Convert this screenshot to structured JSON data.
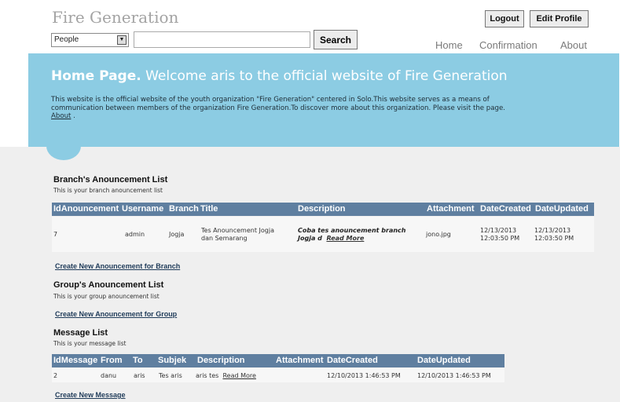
{
  "header": {
    "site_title": "Fire Generation",
    "logout_label": "Logout",
    "edit_profile_label": "Edit Profile",
    "search_category": "People",
    "search_value": "",
    "search_button": "Search",
    "nav": {
      "home": "Home",
      "confirmation": "Confirmation",
      "about": "About"
    }
  },
  "banner": {
    "title_bold": "Home Page.",
    "title_rest": "Welcome aris to the official website of Fire Generation",
    "text_line1": "This website is the official website of the youth organization \"Fire Generation\" centered in Solo.This website serves as a means of",
    "text_line2": "communication between members of the organization Fire Generation.To discover more about this organization. Please visit the page.",
    "about_link": "About",
    "after_link": " ."
  },
  "branch": {
    "title": "Branch's Anouncement List",
    "subtitle": "This is your branch anouncement list",
    "columns": [
      "IdAnouncement",
      "Username",
      "Branch",
      "Title",
      "Description",
      "Attachment",
      "DateCreated",
      "DateUpdated"
    ],
    "rows": [
      {
        "id": "7",
        "username": "admin",
        "branch": "Jogja",
        "title_line1": "Tes Anouncement Jogja",
        "title_line2": "dan Semarang",
        "desc_line1": "Coba tes anouncement branch",
        "desc_line2": "Jogja d",
        "read_more": "Read More",
        "attachment": "jono.jpg",
        "created_date": "12/13/2013",
        "created_time": "12:03:50 PM",
        "updated_date": "12/13/2013",
        "updated_time": "12:03:50 PM"
      }
    ],
    "create_link": "Create New Anouncement for Branch"
  },
  "group": {
    "title": "Group's Anouncement List",
    "subtitle": "This is your group anouncement list",
    "create_link": "Create New Anouncement for Group"
  },
  "messages": {
    "title": "Message List",
    "subtitle": "This is your message list",
    "columns": [
      "IdMessage",
      "From",
      "To",
      "Subjek",
      "Description",
      "Attachment",
      "DateCreated",
      "DateUpdated"
    ],
    "rows": [
      {
        "id": "2",
        "from": "danu",
        "to": "aris",
        "subject": "Tes aris",
        "desc": "aris tes",
        "read_more": "Read More",
        "attachment": "",
        "created": "12/10/2013 1:46:53 PM",
        "updated": "12/10/2013 1:46:53 PM"
      }
    ],
    "create_link": "Create New Message"
  },
  "colors": {
    "banner": "#8ccce3",
    "table_header": "#5f7fa0",
    "content_bg": "#efefef",
    "title_gray": "#a3a3a3"
  }
}
